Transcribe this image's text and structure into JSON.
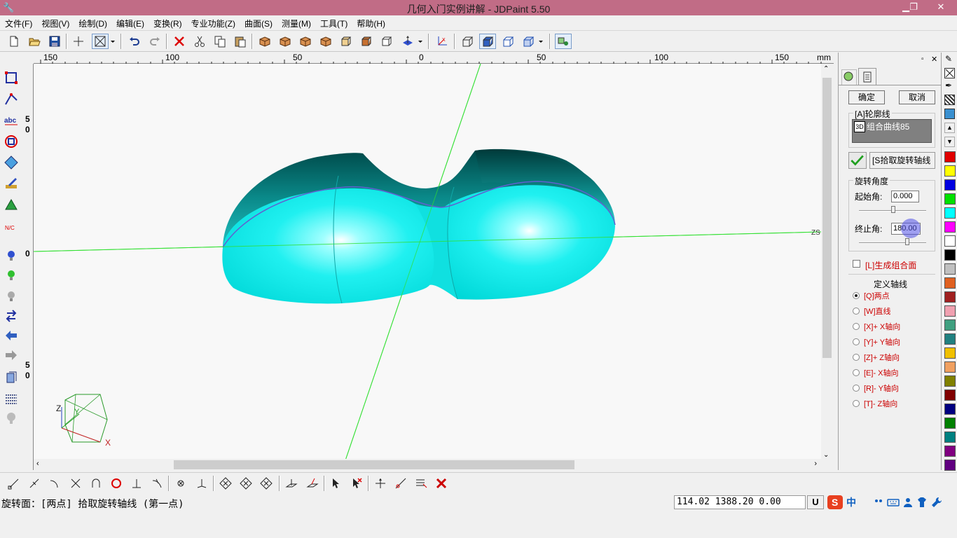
{
  "window": {
    "title": "几何入门实例讲解 - JDPaint 5.50",
    "minimize": "▁",
    "restore": "❐",
    "close": "✕"
  },
  "menu": [
    "文件(F)",
    "视图(V)",
    "绘制(D)",
    "编辑(E)",
    "变换(R)",
    "专业功能(Z)",
    "曲面(S)",
    "测量(M)",
    "工具(T)",
    "帮助(H)"
  ],
  "ruler": {
    "unit": "mm",
    "labels": [
      "150",
      "100",
      "50",
      "0",
      "50",
      "100",
      "150"
    ]
  },
  "vruler": {
    "labels": [
      "5",
      "0",
      "0",
      "5",
      "0"
    ]
  },
  "canvas": {
    "axis_label_z": "Z",
    "axis_label_x": "X",
    "axis_label_y": "Y",
    "corner_label": "ZS"
  },
  "panel": {
    "ok": "确定",
    "cancel": "取消",
    "profile_group": "[A]轮廓线",
    "profile_item": "组合曲线85",
    "profile_item_tag": "3D",
    "pick_axis": "[S拾取旋转轴线",
    "angle_group": "旋转角度",
    "start_label": "起始角:",
    "start_value": "0.000",
    "end_label": "终止角:",
    "end_value": "180.00",
    "generate_combined": "[L]生成组合面",
    "axis_group": "定义轴线",
    "axis_options": [
      {
        "label": "[Q]两点",
        "selected": true
      },
      {
        "label": "[W]直线",
        "selected": false
      },
      {
        "label": "[X]+ X轴向",
        "selected": false
      },
      {
        "label": "[Y]+ Y轴向",
        "selected": false
      },
      {
        "label": "[Z]+ Z轴向",
        "selected": false
      },
      {
        "label": "[E]- X轴向",
        "selected": false
      },
      {
        "label": "[R]- Y轴向",
        "selected": false
      },
      {
        "label": "[T]- Z轴向",
        "selected": false
      }
    ]
  },
  "palette": [
    "#e00000",
    "#ffff00",
    "#0000e0",
    "#00e000",
    "#00ffff",
    "#ff00ff",
    "#ffffff",
    "#000000",
    "#c0c0c0",
    "#e06020",
    "#a02020",
    "#f0a0b0",
    "#40a080",
    "#208080",
    "#f0c000",
    "#f0a060",
    "#808000",
    "#800000",
    "#000080",
    "#008000",
    "#008080",
    "#800080",
    "#600080"
  ],
  "status": {
    "prompt": "旋转面：[两点] 拾取旋转轴线 (第一点)",
    "coords": "114.02 1388.20 0.00",
    "mode": "U",
    "ime_lang": "中"
  }
}
